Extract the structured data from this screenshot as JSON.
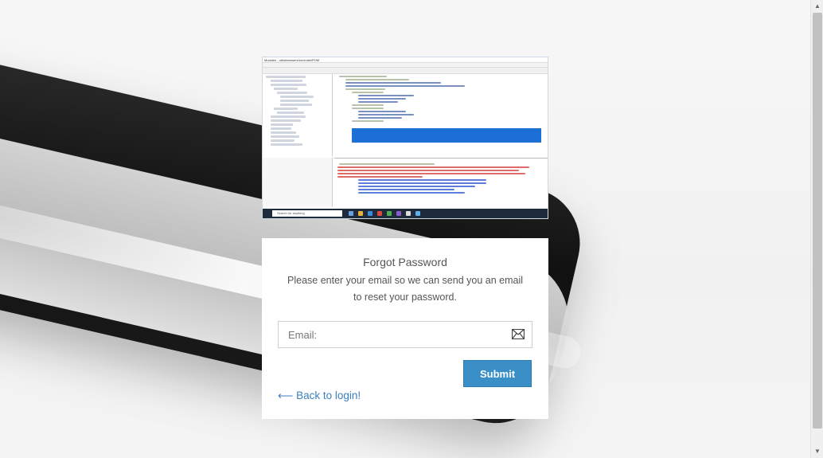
{
  "screenshot": {
    "window_title": "Modules - ultrabrowsers/src/main/POM",
    "search_placeholder": "Search for anything"
  },
  "form": {
    "title": "Forgot Password",
    "description": "Please enter your email so we can send you an email to reset your password.",
    "email_placeholder": "Email:",
    "email_value": "",
    "submit_label": "Submit",
    "back_link_arrow": "⟵",
    "back_link_label": "Back to login!"
  },
  "colors": {
    "accent": "#3b8fc7",
    "link": "#3b7fc0",
    "card_bg": "#ffffff",
    "page_bg": "#f2f2f2"
  },
  "icons": {
    "email": "mail-icon"
  }
}
